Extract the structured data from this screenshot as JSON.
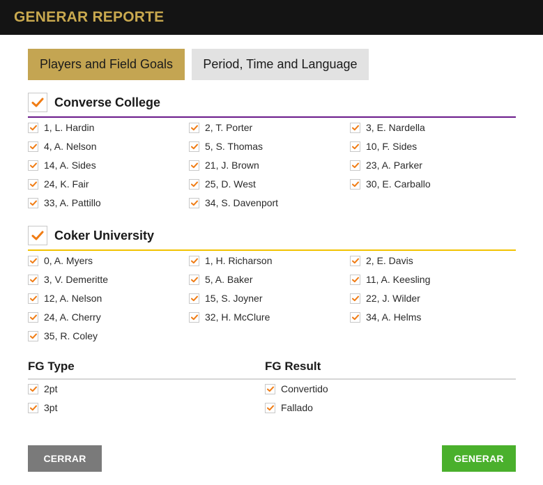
{
  "header": {
    "title": "GENERAR REPORTE"
  },
  "tabs": [
    {
      "label": "Players and Field Goals",
      "active": true
    },
    {
      "label": "Period, Time and Language",
      "active": false
    }
  ],
  "colors": {
    "accent_gold": "#c4a552",
    "check_orange": "#f07c14",
    "team1_rule": "#6a1a8a",
    "team2_rule": "#f2c200",
    "generate_green": "#4ab02c",
    "close_gray": "#7a7a7a"
  },
  "icons": {
    "check": "check-icon"
  },
  "teams": [
    {
      "name": "Converse College",
      "checked": true,
      "players": [
        {
          "label": "1, L. Hardin",
          "checked": true
        },
        {
          "label": "2, T. Porter",
          "checked": true
        },
        {
          "label": "3, E. Nardella",
          "checked": true
        },
        {
          "label": "4, A. Nelson",
          "checked": true
        },
        {
          "label": "5, S. Thomas",
          "checked": true
        },
        {
          "label": "10, F. Sides",
          "checked": true
        },
        {
          "label": "14, A. Sides",
          "checked": true
        },
        {
          "label": "21, J. Brown",
          "checked": true
        },
        {
          "label": "23, A. Parker",
          "checked": true
        },
        {
          "label": "24, K. Fair",
          "checked": true
        },
        {
          "label": "25, D. West",
          "checked": true
        },
        {
          "label": "30, E. Carballo",
          "checked": true
        },
        {
          "label": "33, A. Pattillo",
          "checked": true
        },
        {
          "label": "34, S. Davenport",
          "checked": true
        }
      ]
    },
    {
      "name": "Coker University",
      "checked": true,
      "players": [
        {
          "label": "0, A. Myers",
          "checked": true
        },
        {
          "label": "1, H. Richarson",
          "checked": true
        },
        {
          "label": "2, E. Davis",
          "checked": true
        },
        {
          "label": "3, V. Demeritte",
          "checked": true
        },
        {
          "label": "5, A. Baker",
          "checked": true
        },
        {
          "label": "11, A. Keesling",
          "checked": true
        },
        {
          "label": "12, A. Nelson",
          "checked": true
        },
        {
          "label": "15, S. Joyner",
          "checked": true
        },
        {
          "label": "22, J. Wilder",
          "checked": true
        },
        {
          "label": "24, A. Cherry",
          "checked": true
        },
        {
          "label": "32, H. McClure",
          "checked": true
        },
        {
          "label": "34, A. Helms",
          "checked": true
        },
        {
          "label": "35, R. Coley",
          "checked": true
        }
      ]
    }
  ],
  "fg_type": {
    "title": "FG Type",
    "options": [
      {
        "label": "2pt",
        "checked": true
      },
      {
        "label": "3pt",
        "checked": true
      }
    ]
  },
  "fg_result": {
    "title": "FG Result",
    "options": [
      {
        "label": "Convertido",
        "checked": true
      },
      {
        "label": "Fallado",
        "checked": true
      }
    ]
  },
  "buttons": {
    "close_label": "CERRAR",
    "generate_label": "GENERAR"
  }
}
